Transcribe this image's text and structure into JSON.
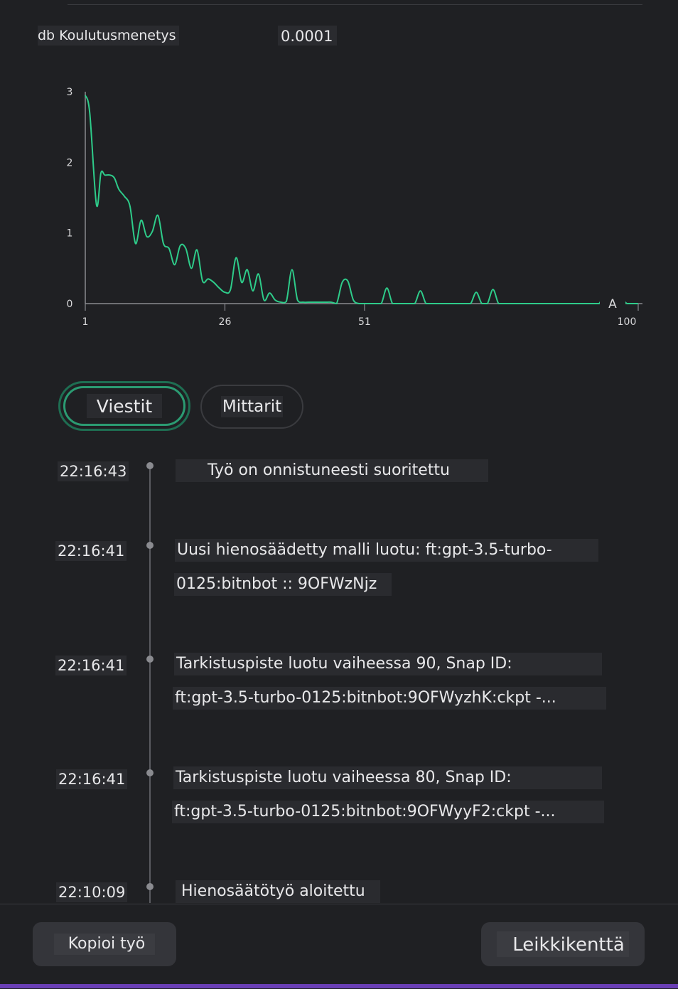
{
  "metric": {
    "name": "db Koulutusmenetys",
    "value": "0.0001"
  },
  "chart_data": {
    "type": "line",
    "x_ticks": [
      "1",
      "26",
      "51",
      "100"
    ],
    "y_ticks": [
      "0",
      "1",
      "2",
      "3"
    ],
    "ylim": [
      0,
      3
    ],
    "xlim": [
      1,
      100
    ],
    "end_marker": "A",
    "line_color": "#2ecc8a",
    "series": [
      {
        "x": [
          1,
          1.8,
          3,
          3.8,
          4.5,
          5.4,
          6.2,
          7,
          8,
          9,
          10,
          11,
          12,
          13,
          14,
          15,
          16,
          17,
          18,
          19,
          20,
          21,
          22,
          23,
          24,
          25,
          26,
          27,
          28,
          29,
          30,
          31,
          32,
          33,
          34,
          35,
          36,
          37,
          38,
          39,
          40,
          41,
          42,
          43,
          44,
          45,
          46,
          47,
          48,
          49,
          50,
          51,
          52,
          53,
          54,
          55,
          56,
          57,
          58,
          59,
          60,
          61,
          62,
          63,
          64,
          65,
          66,
          67,
          68,
          69,
          70,
          71,
          72,
          73,
          74,
          75,
          76,
          77,
          78,
          79,
          80,
          81,
          82,
          83,
          84,
          85,
          86,
          87,
          88,
          89,
          90,
          91,
          92,
          93,
          94,
          95,
          96,
          97,
          98,
          99,
          100
        ],
        "y": [
          2.95,
          2.7,
          1.4,
          1.85,
          1.82,
          1.82,
          1.78,
          1.62,
          1.52,
          1.38,
          0.85,
          1.18,
          0.95,
          1.02,
          1.25,
          0.85,
          0.78,
          0.55,
          0.82,
          0.78,
          0.5,
          0.76,
          0.32,
          0.35,
          0.3,
          0.22,
          0.16,
          0.2,
          0.65,
          0.3,
          0.48,
          0.18,
          0.42,
          0.05,
          0.15,
          0.05,
          0.02,
          0.03,
          0.48,
          0.05,
          0.02,
          0.02,
          0.02,
          0.02,
          0.02,
          0.02,
          0.0,
          0.3,
          0.32,
          0.05,
          0.0,
          0.0,
          0.0,
          0.0,
          0.0,
          0.22,
          0.0,
          0.0,
          0.0,
          0.0,
          0.0,
          0.18,
          0.0,
          0.0,
          0.0,
          0.0,
          0.0,
          0.0,
          0.0,
          0.0,
          0.0,
          0.16,
          0.0,
          0.0,
          0.2,
          0.0,
          0.0,
          0.0,
          0.0,
          0.0,
          0.0,
          0.0,
          0.0,
          0.0,
          0.0,
          0.0,
          0.0,
          0.0,
          0.0,
          0.0,
          0.0,
          0.0,
          0.0,
          0.0,
          0.13,
          0.0,
          0.0,
          0.06,
          0.0,
          0.0,
          0.0
        ]
      }
    ]
  },
  "tabs": [
    {
      "label": "Viestit",
      "active": true
    },
    {
      "label": "Mittarit",
      "active": false
    }
  ],
  "events": [
    {
      "time": "22:16:43",
      "lines": [
        "Työ on onnistuneesti suoritettu"
      ]
    },
    {
      "time": "22:16:41",
      "lines": [
        "Uusi hienosäädetty malli luotu: ft:gpt-3.5-turbo-",
        "0125:bitnbot :: 9OFWzNjz"
      ]
    },
    {
      "time": "22:16:41",
      "lines": [
        "Tarkistuspiste luotu vaiheessa 90, Snap ID:",
        "ft:gpt-3.5-turbo-0125:bitnbot:9OFWyzhK:ckpt -..."
      ]
    },
    {
      "time": "22:16:41",
      "lines": [
        "Tarkistuspiste luotu vaiheessa 80, Snap ID:",
        "ft:gpt-3.5-turbo-0125:bitnbot:9OFWyyF2:ckpt -..."
      ]
    },
    {
      "time": "22:10:09",
      "lines": [
        "Hienosäätötyö aloitettu"
      ]
    }
  ],
  "buttons": {
    "copy": "Kopioi työ",
    "playground": "Leikkikenttä"
  },
  "colors": {
    "accent": "#2b9b72",
    "bottom_bar": "#6a3fb5"
  }
}
